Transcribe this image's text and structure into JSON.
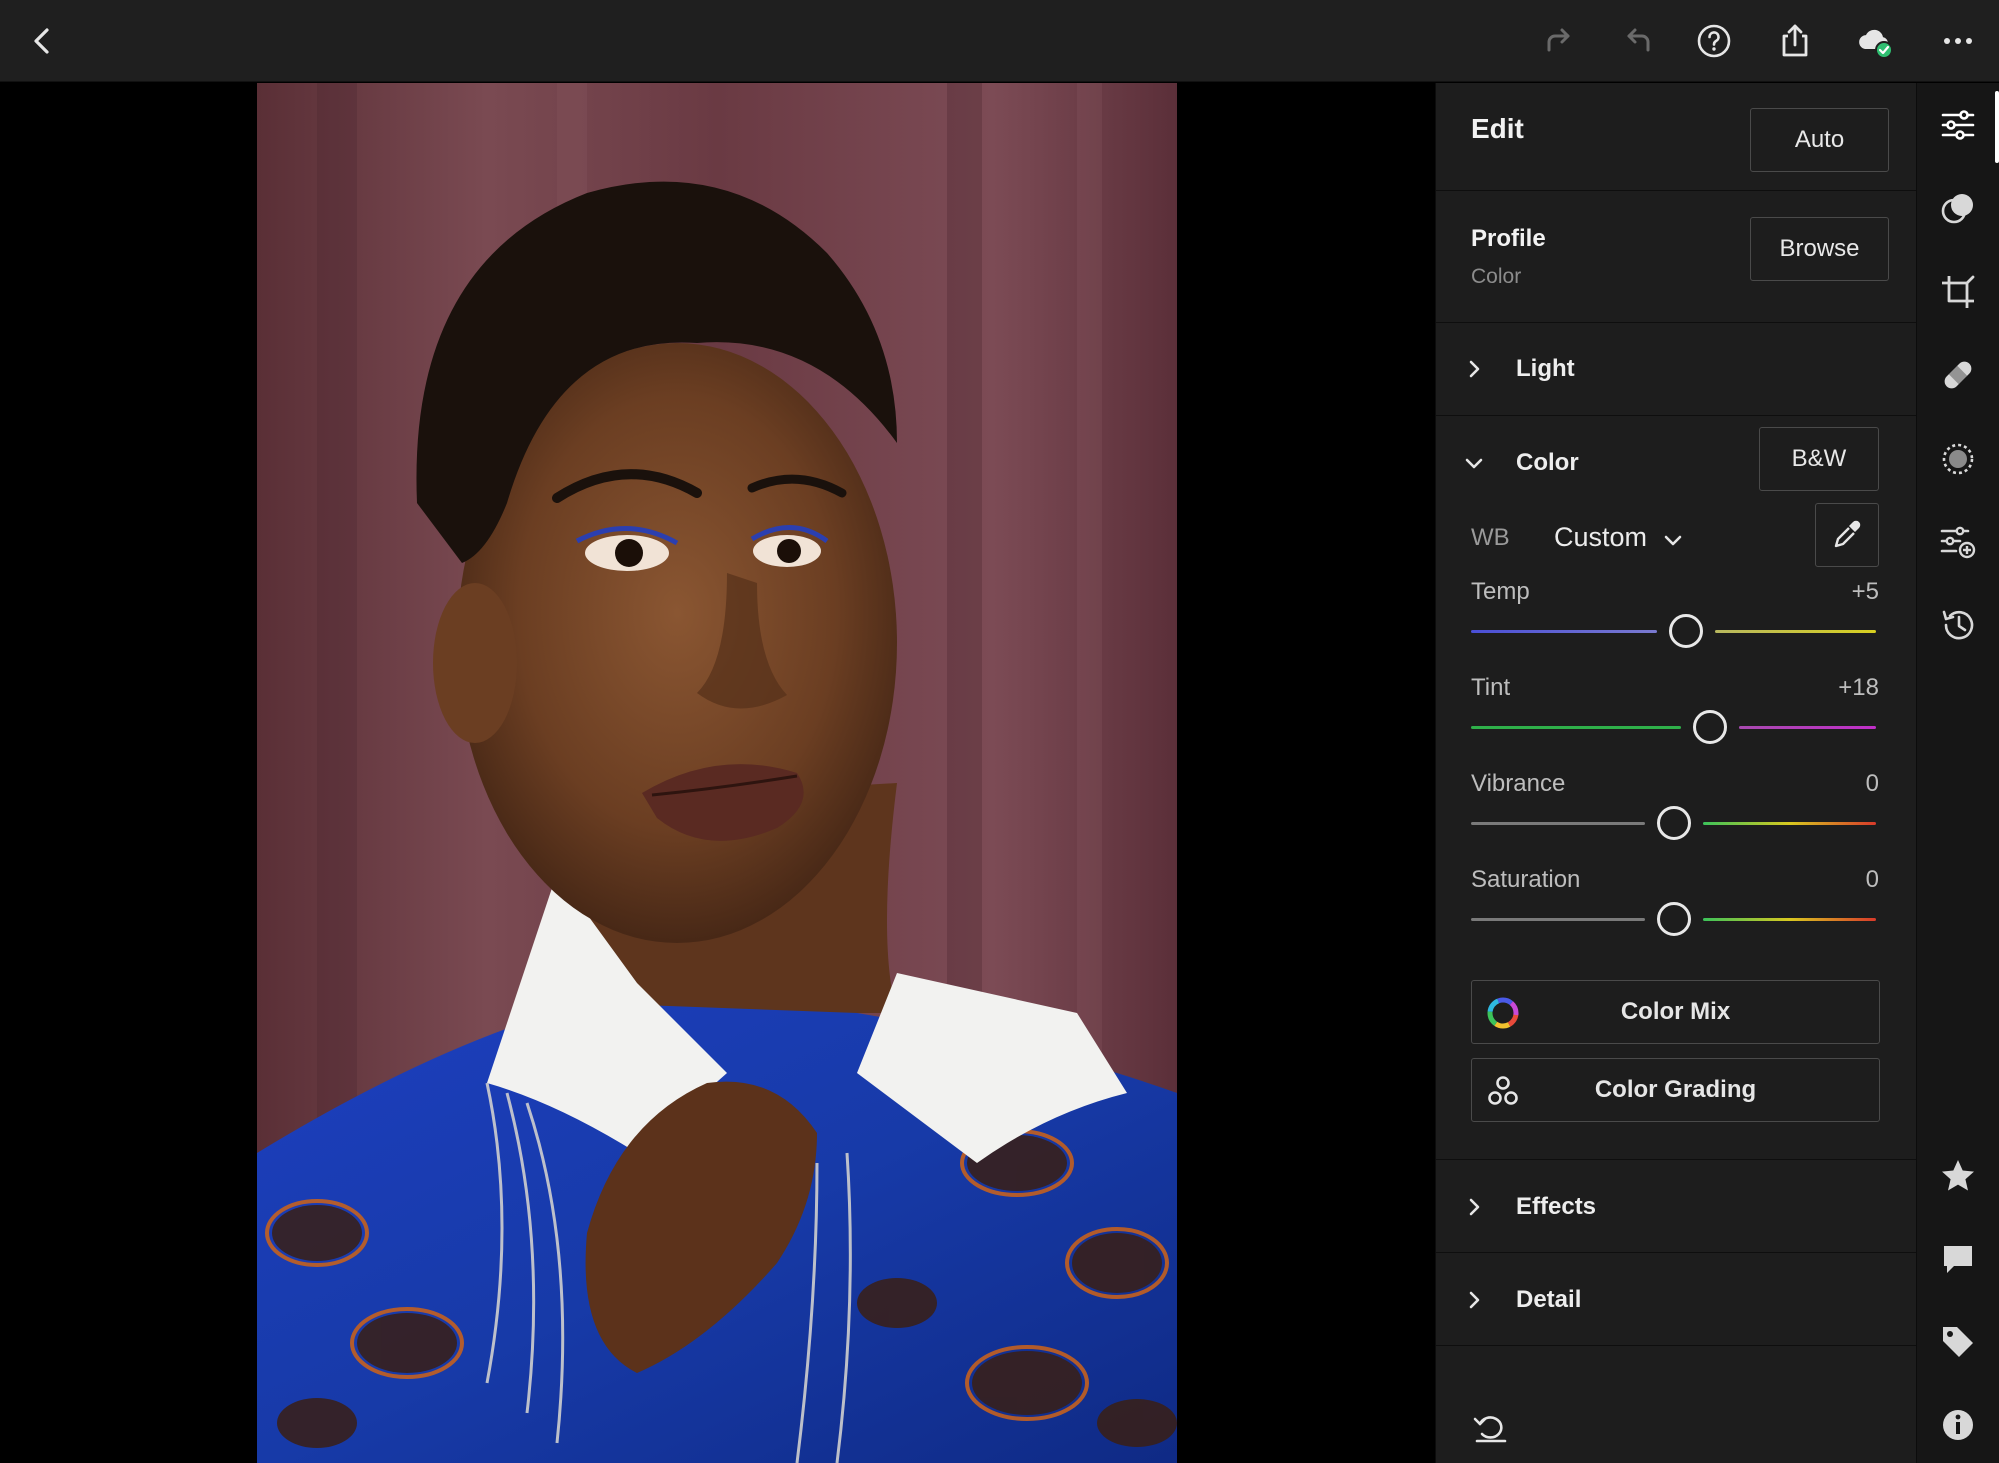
{
  "topbar": {
    "icons": [
      "back-icon",
      "redo-icon",
      "undo-icon",
      "help-icon",
      "share-icon",
      "cloud-sync-icon",
      "more-icon"
    ]
  },
  "photo": {
    "subject": "portrait"
  },
  "panel": {
    "title": "Edit",
    "auto_label": "Auto",
    "profile": {
      "label": "Profile",
      "value": "Color",
      "browse_label": "Browse"
    },
    "light": {
      "label": "Light",
      "expanded": false
    },
    "color": {
      "label": "Color",
      "expanded": true,
      "bw_label": "B&W",
      "wb_label": "WB",
      "wb_value": "Custom",
      "sliders": [
        {
          "label": "Temp",
          "value": "+5",
          "position": 0.53,
          "gradient": [
            "#4a4fd6",
            "#d8d020"
          ]
        },
        {
          "label": "Tint",
          "value": "+18",
          "position": 0.59,
          "gradient": [
            "#2fb04a",
            "#c02fc8"
          ]
        },
        {
          "label": "Vibrance",
          "value": "0",
          "position": 0.5,
          "gradient": [
            "#7a7a7a",
            "#d83a2a"
          ]
        },
        {
          "label": "Saturation",
          "value": "0",
          "position": 0.5,
          "gradient": [
            "#7a7a7a",
            "#d83a2a"
          ]
        }
      ],
      "color_mix_label": "Color Mix",
      "color_grading_label": "Color Grading"
    },
    "effects": {
      "label": "Effects",
      "expanded": false
    },
    "detail": {
      "label": "Detail",
      "expanded": false
    }
  },
  "rail": {
    "top_icons": [
      "edit-sliders-icon",
      "presets-icon",
      "crop-icon",
      "healing-icon",
      "masking-icon",
      "versions-icon",
      "history-icon"
    ],
    "bottom_icons": [
      "star-icon",
      "comment-icon",
      "tag-icon",
      "info-icon"
    ],
    "active": "edit-sliders-icon"
  },
  "colors": {
    "accent_green": "#2fbf71",
    "panel_bg": "#1d1d1d",
    "topbar_bg": "#1f1f1f"
  }
}
